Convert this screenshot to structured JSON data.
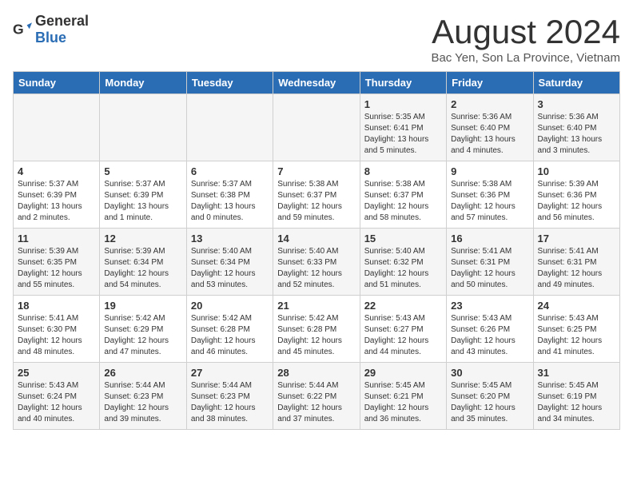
{
  "header": {
    "logo_general": "General",
    "logo_blue": "Blue",
    "month_title": "August 2024",
    "location": "Bac Yen, Son La Province, Vietnam"
  },
  "days_of_week": [
    "Sunday",
    "Monday",
    "Tuesday",
    "Wednesday",
    "Thursday",
    "Friday",
    "Saturday"
  ],
  "weeks": [
    [
      {
        "day": "",
        "content": ""
      },
      {
        "day": "",
        "content": ""
      },
      {
        "day": "",
        "content": ""
      },
      {
        "day": "",
        "content": ""
      },
      {
        "day": "1",
        "content": "Sunrise: 5:35 AM\nSunset: 6:41 PM\nDaylight: 13 hours\nand 5 minutes."
      },
      {
        "day": "2",
        "content": "Sunrise: 5:36 AM\nSunset: 6:40 PM\nDaylight: 13 hours\nand 4 minutes."
      },
      {
        "day": "3",
        "content": "Sunrise: 5:36 AM\nSunset: 6:40 PM\nDaylight: 13 hours\nand 3 minutes."
      }
    ],
    [
      {
        "day": "4",
        "content": "Sunrise: 5:37 AM\nSunset: 6:39 PM\nDaylight: 13 hours\nand 2 minutes."
      },
      {
        "day": "5",
        "content": "Sunrise: 5:37 AM\nSunset: 6:39 PM\nDaylight: 13 hours\nand 1 minute."
      },
      {
        "day": "6",
        "content": "Sunrise: 5:37 AM\nSunset: 6:38 PM\nDaylight: 13 hours\nand 0 minutes."
      },
      {
        "day": "7",
        "content": "Sunrise: 5:38 AM\nSunset: 6:37 PM\nDaylight: 12 hours\nand 59 minutes."
      },
      {
        "day": "8",
        "content": "Sunrise: 5:38 AM\nSunset: 6:37 PM\nDaylight: 12 hours\nand 58 minutes."
      },
      {
        "day": "9",
        "content": "Sunrise: 5:38 AM\nSunset: 6:36 PM\nDaylight: 12 hours\nand 57 minutes."
      },
      {
        "day": "10",
        "content": "Sunrise: 5:39 AM\nSunset: 6:36 PM\nDaylight: 12 hours\nand 56 minutes."
      }
    ],
    [
      {
        "day": "11",
        "content": "Sunrise: 5:39 AM\nSunset: 6:35 PM\nDaylight: 12 hours\nand 55 minutes."
      },
      {
        "day": "12",
        "content": "Sunrise: 5:39 AM\nSunset: 6:34 PM\nDaylight: 12 hours\nand 54 minutes."
      },
      {
        "day": "13",
        "content": "Sunrise: 5:40 AM\nSunset: 6:34 PM\nDaylight: 12 hours\nand 53 minutes."
      },
      {
        "day": "14",
        "content": "Sunrise: 5:40 AM\nSunset: 6:33 PM\nDaylight: 12 hours\nand 52 minutes."
      },
      {
        "day": "15",
        "content": "Sunrise: 5:40 AM\nSunset: 6:32 PM\nDaylight: 12 hours\nand 51 minutes."
      },
      {
        "day": "16",
        "content": "Sunrise: 5:41 AM\nSunset: 6:31 PM\nDaylight: 12 hours\nand 50 minutes."
      },
      {
        "day": "17",
        "content": "Sunrise: 5:41 AM\nSunset: 6:31 PM\nDaylight: 12 hours\nand 49 minutes."
      }
    ],
    [
      {
        "day": "18",
        "content": "Sunrise: 5:41 AM\nSunset: 6:30 PM\nDaylight: 12 hours\nand 48 minutes."
      },
      {
        "day": "19",
        "content": "Sunrise: 5:42 AM\nSunset: 6:29 PM\nDaylight: 12 hours\nand 47 minutes."
      },
      {
        "day": "20",
        "content": "Sunrise: 5:42 AM\nSunset: 6:28 PM\nDaylight: 12 hours\nand 46 minutes."
      },
      {
        "day": "21",
        "content": "Sunrise: 5:42 AM\nSunset: 6:28 PM\nDaylight: 12 hours\nand 45 minutes."
      },
      {
        "day": "22",
        "content": "Sunrise: 5:43 AM\nSunset: 6:27 PM\nDaylight: 12 hours\nand 44 minutes."
      },
      {
        "day": "23",
        "content": "Sunrise: 5:43 AM\nSunset: 6:26 PM\nDaylight: 12 hours\nand 43 minutes."
      },
      {
        "day": "24",
        "content": "Sunrise: 5:43 AM\nSunset: 6:25 PM\nDaylight: 12 hours\nand 41 minutes."
      }
    ],
    [
      {
        "day": "25",
        "content": "Sunrise: 5:43 AM\nSunset: 6:24 PM\nDaylight: 12 hours\nand 40 minutes."
      },
      {
        "day": "26",
        "content": "Sunrise: 5:44 AM\nSunset: 6:23 PM\nDaylight: 12 hours\nand 39 minutes."
      },
      {
        "day": "27",
        "content": "Sunrise: 5:44 AM\nSunset: 6:23 PM\nDaylight: 12 hours\nand 38 minutes."
      },
      {
        "day": "28",
        "content": "Sunrise: 5:44 AM\nSunset: 6:22 PM\nDaylight: 12 hours\nand 37 minutes."
      },
      {
        "day": "29",
        "content": "Sunrise: 5:45 AM\nSunset: 6:21 PM\nDaylight: 12 hours\nand 36 minutes."
      },
      {
        "day": "30",
        "content": "Sunrise: 5:45 AM\nSunset: 6:20 PM\nDaylight: 12 hours\nand 35 minutes."
      },
      {
        "day": "31",
        "content": "Sunrise: 5:45 AM\nSunset: 6:19 PM\nDaylight: 12 hours\nand 34 minutes."
      }
    ]
  ]
}
